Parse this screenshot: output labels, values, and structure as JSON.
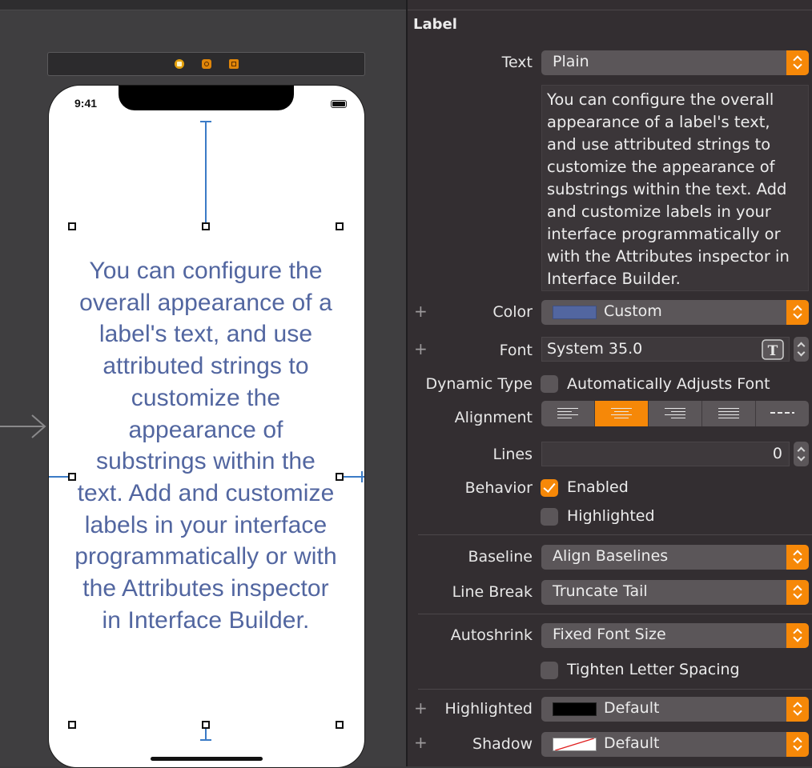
{
  "phone": {
    "status_time": "9:41",
    "label_text": "You can configure the overall appearance of a label's text, and use attributed strings to customize the appearance of substrings within the text. Add and customize labels in your interface programmatically or with the Attributes inspector in Interface Builder."
  },
  "inspector": {
    "section_title": "Label",
    "text": {
      "label": "Text",
      "value": "Plain"
    },
    "text_content": "You can configure the overall appearance of a label's text, and use attributed strings to customize the appearance of substrings within the text. Add and customize labels in your interface programmatically or with the Attributes inspector in Interface Builder.",
    "color": {
      "label": "Color",
      "value": "Custom",
      "swatch": "#5266a0"
    },
    "font": {
      "label": "Font",
      "value": "System 35.0"
    },
    "dynamic_type": {
      "label": "Dynamic Type",
      "option": "Automatically Adjusts Font",
      "checked": false
    },
    "alignment": {
      "label": "Alignment",
      "options": [
        "left",
        "center",
        "right",
        "justified",
        "natural"
      ],
      "selected": "center"
    },
    "lines": {
      "label": "Lines",
      "value": "0"
    },
    "behavior": {
      "label": "Behavior",
      "enabled_label": "Enabled",
      "enabled": true,
      "highlighted_label": "Highlighted",
      "highlighted": false
    },
    "baseline": {
      "label": "Baseline",
      "value": "Align Baselines"
    },
    "line_break": {
      "label": "Line Break",
      "value": "Truncate Tail"
    },
    "autoshrink": {
      "label": "Autoshrink",
      "value": "Fixed Font Size"
    },
    "tighten": {
      "label": "Tighten Letter Spacing",
      "checked": false
    },
    "highlighted_color": {
      "label": "Highlighted",
      "value": "Default",
      "swatch": "#000000"
    },
    "shadow": {
      "label": "Shadow",
      "value": "Default",
      "swatch": "none"
    },
    "plus_symbol": "+"
  },
  "colors": {
    "accent": "#f68808",
    "label_blue": "#5266a0"
  }
}
